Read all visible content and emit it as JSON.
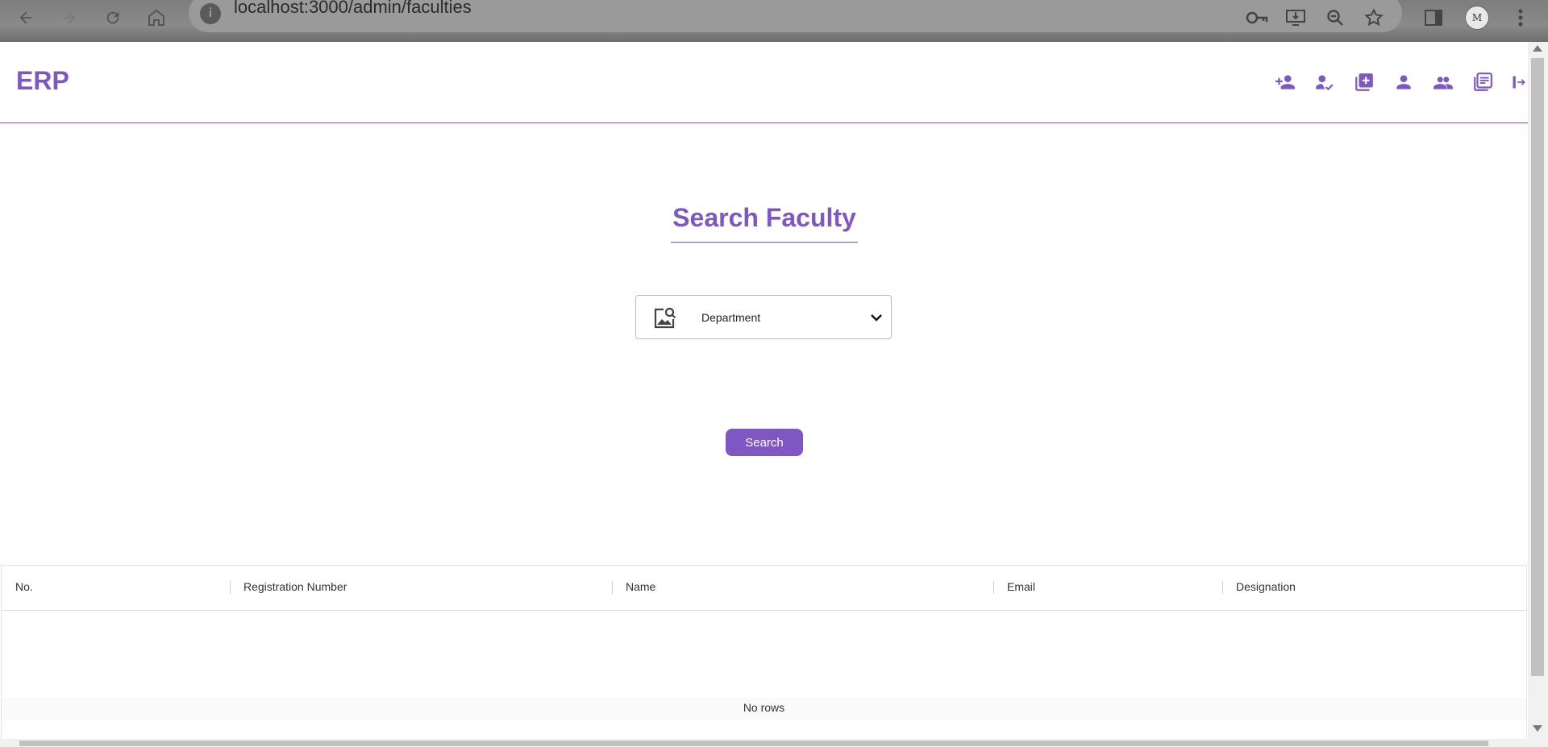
{
  "browser": {
    "url": "localhost:3000/admin/faculties",
    "profile_initials": "M"
  },
  "header": {
    "logo": "ERP",
    "icons": [
      "add-person-icon",
      "person-check-icon",
      "add-box-icon",
      "person-icon",
      "group-icon",
      "library-books-icon",
      "logout-icon"
    ]
  },
  "main": {
    "title": "Search Faculty",
    "department_select": {
      "label": "Department"
    },
    "search_button": "Search"
  },
  "table": {
    "columns": [
      "No.",
      "Registration Number",
      "Name",
      "Email",
      "Designation"
    ],
    "empty_message": "No rows"
  },
  "colors": {
    "accent": "#7e57c2"
  }
}
